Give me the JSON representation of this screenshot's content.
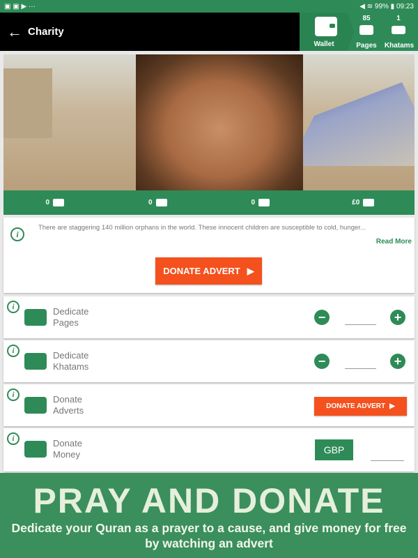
{
  "status_bar": {
    "left_icons": "▣ ▣ ▶ ···",
    "right": "◀ ≋ 99% ▮ 09:23"
  },
  "toolbar": {
    "back_icon": "←",
    "title": "Charity",
    "wallet_label": "Wallet",
    "pages_count": "85",
    "pages_label": "Pages",
    "khatams_count": "1",
    "khatams_label": "Khatams"
  },
  "stats": {
    "pages": "0",
    "khatams": "0",
    "adverts": "0",
    "money": "£0"
  },
  "info_card": {
    "description": "There are staggering 140 million orphans in the world. These innocent children are susceptible to cold, hunger...",
    "read_more": "Read More",
    "button": "DONATE ADVERT"
  },
  "rows": [
    {
      "line1": "Dedicate",
      "line2": "Pages",
      "icon": "quran-stand-icon"
    },
    {
      "line1": "Dedicate",
      "line2": "Khatams",
      "icon": "book-icon"
    },
    {
      "line1": "Donate",
      "line2": "Adverts",
      "icon": "play-icon",
      "button": "DONATE ADVERT"
    },
    {
      "line1": "Donate",
      "line2": "Money",
      "icon": "money-hand-icon",
      "currency": "GBP"
    }
  ],
  "banner": {
    "title": "PRAY AND DONATE",
    "subtitle": "Dedicate your Quran as a prayer to a cause, and give money for free by watching an advert"
  },
  "colors": {
    "green": "#2e8b57",
    "orange": "#f4511e",
    "banner": "#3a8f5c"
  }
}
